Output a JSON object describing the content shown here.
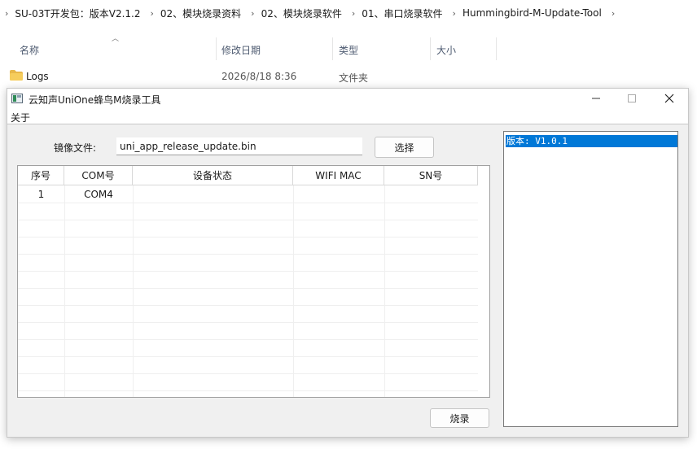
{
  "breadcrumb": [
    "SU-03T开发包：版本V2.1.2",
    "02、模块烧录资料",
    "02、模块烧录软件",
    "01、串口烧录软件",
    "Hummingbird-M-Update-Tool"
  ],
  "explorer": {
    "columns": {
      "name": "名称",
      "modified": "修改日期",
      "type": "类型",
      "size": "大小"
    },
    "sort_icon": "chevron-up-icon",
    "file": {
      "name": "Logs",
      "modified": "2026/8/18 8:36",
      "type": "文件夹",
      "icon": "folder-icon"
    }
  },
  "app": {
    "title": "云知声UniOne蜂鸟M烧录工具",
    "menu": {
      "about": "关于"
    },
    "image_label": "镜像文件:",
    "image_value": "uni_app_release_update.bin",
    "choose_label": "选择",
    "burn_label": "烧录",
    "table": {
      "headers": [
        "序号",
        "COM号",
        "设备状态",
        "WIFI MAC",
        "SN号"
      ],
      "rows": [
        [
          "1",
          "COM4",
          "",
          "",
          ""
        ]
      ]
    },
    "version_text": "版本: V1.0.1"
  },
  "colors": {
    "selection": "#0078d7",
    "window_bg": "#f0f0f0",
    "folder": "#e8b84a"
  }
}
